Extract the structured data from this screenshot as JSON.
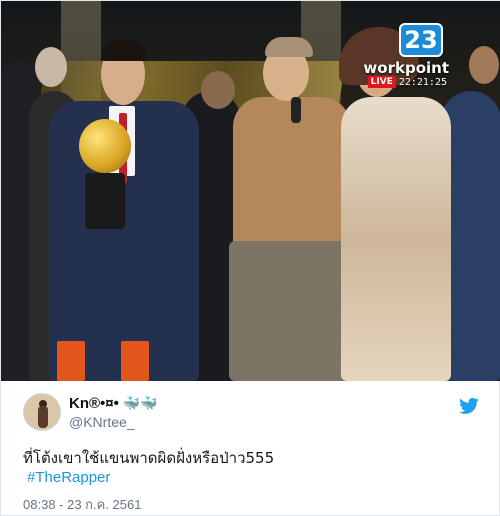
{
  "media": {
    "channel_number": "23",
    "channel_brand": "workpoint",
    "live_label": "LIVE",
    "live_time": "22:21:25"
  },
  "tweet": {
    "display_name": "Kn®•¤•",
    "display_name_emoji": "🐳🐳",
    "handle": "@KNrtee_",
    "text": "ที่โต้งเขาใช้แขนพาดผิดฝั่งหรือป่าว555",
    "hashtag": "#TheRapper",
    "timestamp": "08:38 - 23 ก.ค. 2561"
  },
  "colors": {
    "link": "#1b95e0",
    "muted": "#657786",
    "twitter_blue": "#1da1f2",
    "live_red": "#e0161b"
  },
  "icons": {
    "brand": "twitter-bird-icon"
  }
}
